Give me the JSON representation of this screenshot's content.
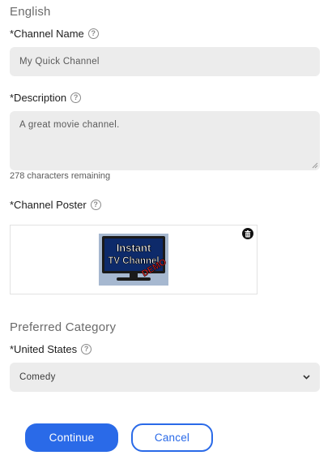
{
  "language_section": {
    "title": "English"
  },
  "channel_name": {
    "label": "*Channel Name",
    "placeholder": "My Quick Channel",
    "value": ""
  },
  "description": {
    "label": "*Description",
    "value": "A great movie channel.",
    "chars_remaining": "278 characters remaining"
  },
  "channel_poster": {
    "label": "*Channel Poster",
    "image_text_line1": "Instant",
    "image_text_line2": "TV Channel",
    "image_stamp": "DEMO",
    "delete_icon": "trash-icon"
  },
  "category_section": {
    "title": "Preferred Category",
    "region_label": "*United States",
    "selected": "Comedy"
  },
  "actions": {
    "continue_label": "Continue",
    "cancel_label": "Cancel"
  },
  "colors": {
    "accent": "#2a6ae8",
    "field_bg": "#ececec"
  }
}
